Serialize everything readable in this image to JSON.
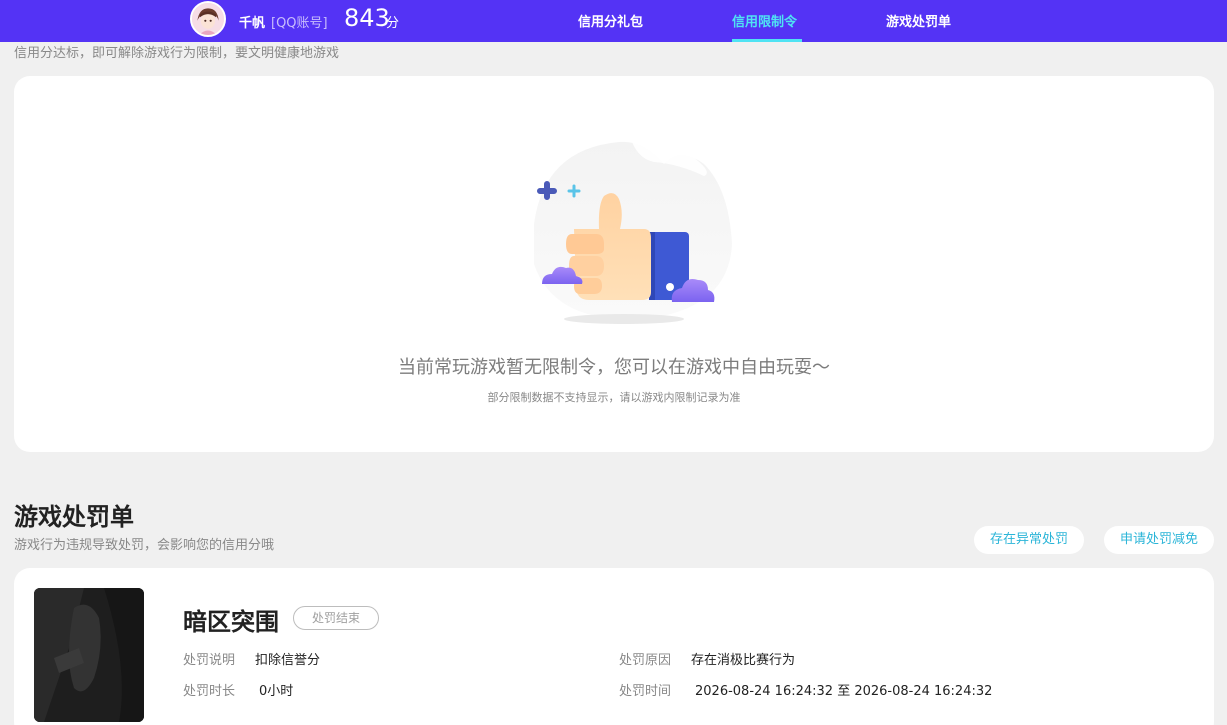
{
  "header": {
    "username": "千帆",
    "account_type": "[QQ账号]",
    "score": "843",
    "score_unit": "分",
    "tabs": [
      {
        "label": "信用分礼包",
        "active": false
      },
      {
        "label": "信用限制令",
        "active": true
      },
      {
        "label": "游戏处罚单",
        "active": false
      }
    ],
    "colors": {
      "bar": "#5433f5",
      "active_tab": "#4fe3f3"
    }
  },
  "restriction": {
    "subtitle": "信用分达标，即可解除游戏行为限制，要文明健康地游戏",
    "empty_title": "当前常玩游戏暂无限制令，您可以在游戏中自由玩耍～",
    "empty_note": "部分限制数据不支持显示，请以游戏内限制记录为准",
    "illustration_icon": "thumbs-up-icon"
  },
  "penalty": {
    "title": "游戏处罚单",
    "subtitle": "游戏行为违规导致处罚，会影响您的信用分哦",
    "buttons": {
      "abnormal": "存在异常处罚",
      "reduce": "申请处罚减免"
    },
    "records": [
      {
        "game": "暗区突围",
        "status": "处罚结束",
        "desc_label": "处罚说明",
        "desc_value": "扣除信誉分",
        "reason_label": "处罚原因",
        "reason_value": "存在消极比赛行为",
        "duration_label": "处罚时长",
        "duration_value": "0小时",
        "time_label": "处罚时间",
        "time_value": "2026-08-24 16:24:32 至 2026-08-24 16:24:32"
      }
    ]
  }
}
